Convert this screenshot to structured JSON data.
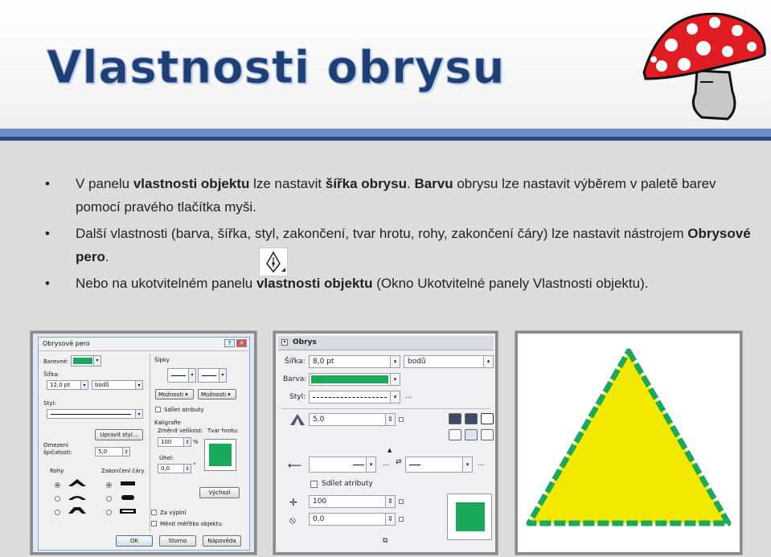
{
  "slide": {
    "title": "Vlastnosti obrysu"
  },
  "bullets": [
    {
      "marker": "•",
      "segments": [
        {
          "text": "V panelu ",
          "bold": false
        },
        {
          "text": "vlastnosti objektu",
          "bold": true
        },
        {
          "text": " lze nastavit ",
          "bold": false
        },
        {
          "text": "šířka obrysu",
          "bold": true
        },
        {
          "text": ". ",
          "bold": false
        },
        {
          "text": "Barvu",
          "bold": true
        },
        {
          "text": " obrysu lze nastavit výběrem v paletě barev pomocí pravého tlačítka myši.",
          "bold": false
        }
      ]
    },
    {
      "marker": "•",
      "segments": [
        {
          "text": "Další vlastnosti (barva, šířka, styl, zakončení, tvar hrotu, rohy, zakončení čáry) lze nastavit nástrojem ",
          "bold": false
        },
        {
          "text": "Obrysové pero",
          "bold": true
        },
        {
          "text": ".",
          "bold": false
        }
      ]
    },
    {
      "marker": "•",
      "segments": [
        {
          "text": "Nebo na ukotvitelném panelu ",
          "bold": false
        },
        {
          "text": "vlastnosti objektu",
          "bold": true
        },
        {
          "text": " (Okno Ukotvitelné panely Vlastnosti objektu).",
          "bold": false
        }
      ]
    }
  ],
  "dialog": {
    "title": "Obrysové pero",
    "help_glyph": "?",
    "close_glyph": "✕",
    "color_label": "Barevné:",
    "width_label": "Šířka:",
    "width_value": "12,0 pt",
    "unit_value": "bodů",
    "style_label": "Styl:",
    "edit_style_button": "Upravit styl...",
    "taper_label_1": "Omezení",
    "taper_label_2": "špičatosti:",
    "taper_value": "5,0",
    "corners_label": "Rohy",
    "line_caps_label": "Zakončení čáry",
    "arrows_label": "Šipky",
    "options_left": "Možnosti",
    "options_right": "Možnosti",
    "share_attributes": "Sdílet atributy",
    "calligraphy_label": "Kaligrafie",
    "stretch_label": "Změnit velikost:",
    "stretch_value": "100",
    "stretch_unit": "%",
    "angle_label": "Úhel:",
    "angle_value": "0,0",
    "angle_unit": "°",
    "nib_shape_label": "Tvar hrotu:",
    "default_button": "Výchozí",
    "behind_fill": "Za výplní",
    "scale_with_object": "Měnit měřítko objektu",
    "ok_button": "OK",
    "cancel_button": "Storno",
    "help_button": "Nápověda",
    "outline_color": "#1aa85a"
  },
  "docker": {
    "title": "Obrys",
    "width_label": "Šířka:",
    "width_value": "8,0 pt",
    "unit_value": "bodů",
    "color_label": "Barva:",
    "style_label": "Styl:",
    "style_more": "...",
    "taper_value": "5,0",
    "arrow_more_left": "...",
    "arrow_more_right": "...",
    "share_attributes": "Sdílet atributy",
    "stretch_value": "100",
    "angle_value": "0,0",
    "outline_color": "#1aa85a"
  },
  "preview": {
    "fill_color": "#f2e800",
    "outline_color": "#1aa85a"
  },
  "colors": {
    "title": "#1f3f73",
    "accent_bar": "#6f8fc8",
    "accent_bar_dark": "#2b4d86",
    "mushroom_cap": "#e11b22"
  }
}
